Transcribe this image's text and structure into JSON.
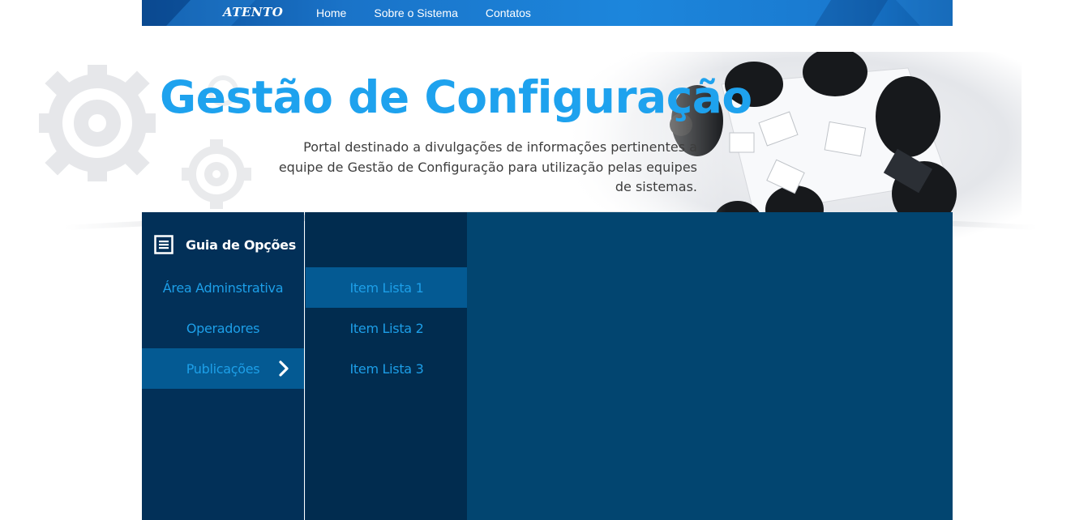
{
  "nav": {
    "logo": "ATENTO",
    "links": [
      "Home",
      "Sobre o Sistema",
      "Contatos"
    ]
  },
  "hero": {
    "title": "Gestão de Configuração",
    "description": "Portal destinado a divulgações de informações pertinentes a equipe de Gestão de Configuração para utilização pelas equipes de sistemas."
  },
  "sidebar": {
    "header": "Guia de Opções",
    "items": [
      {
        "label": "Área Adminstrativa",
        "active": false
      },
      {
        "label": "Operadores",
        "active": false
      },
      {
        "label": "Publicações",
        "active": true
      }
    ]
  },
  "submenu": {
    "items": [
      {
        "label": "Item Lista 1",
        "active": true
      },
      {
        "label": "Item Lista 2",
        "active": false
      },
      {
        "label": "Item Lista 3",
        "active": false
      }
    ]
  },
  "colors": {
    "accent": "#1ea2ee",
    "panel_dark": "#023058",
    "panel_right": "#024570",
    "active_item": "#045a93"
  },
  "icons": {
    "guide": "list-document-icon",
    "chevron": "chevron-right-icon",
    "gears": "gear-icon"
  }
}
